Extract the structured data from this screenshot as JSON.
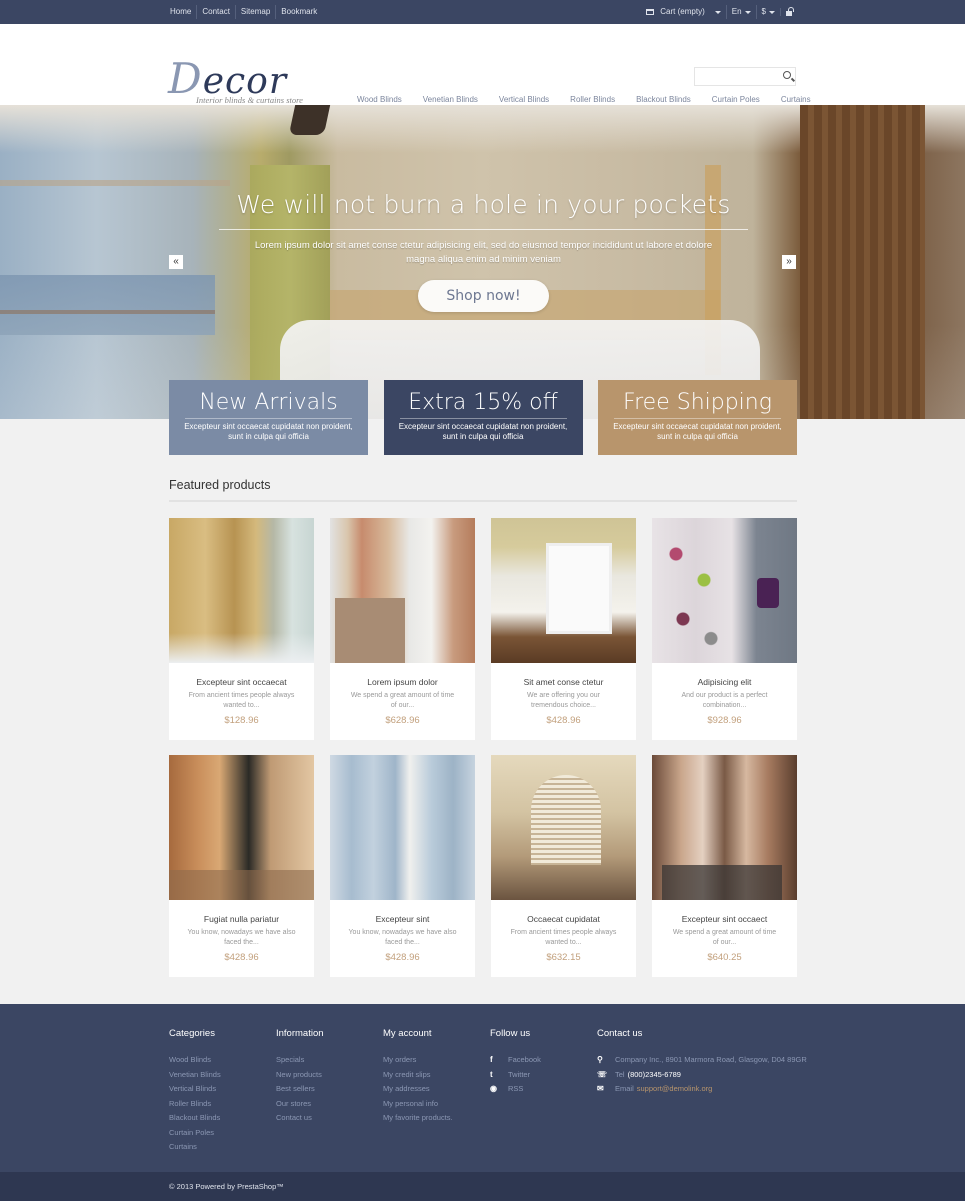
{
  "topbar": {
    "links": [
      "Home",
      "Contact",
      "Sitemap",
      "Bookmark"
    ],
    "cart_label": "Cart",
    "cart_status": "(empty)",
    "language": "En",
    "currency": "$",
    "icons": {
      "cart": "cart-icon",
      "account": "lock-icon"
    }
  },
  "header": {
    "logo_first_letter": "D",
    "logo_rest": "ecor",
    "tagline": "Interior blinds & curtains store",
    "search": {
      "value": "",
      "placeholder": ""
    },
    "nav": [
      "Wood Blinds",
      "Venetian Blinds",
      "Vertical Blinds",
      "Roller Blinds",
      "Blackout Blinds",
      "Curtain Poles",
      "Curtains"
    ]
  },
  "hero": {
    "title": "We will not burn a hole in your pockets",
    "text": "Lorem ipsum dolor sit amet conse ctetur adipisicing elit, sed do eiusmod tempor incididunt ut labore et dolore magna aliqua enim ad minim veniam",
    "button": "Shop now!",
    "prev_arrow": "«",
    "next_arrow": "»"
  },
  "promos": [
    {
      "title": "New Arrivals",
      "text": "Excepteur sint occaecat cupidatat non proident, sunt in culpa qui officia",
      "color": "#7b8ba5"
    },
    {
      "title": "Extra 15% off",
      "text": "Excepteur sint occaecat cupidatat non proident, sunt in culpa qui officia",
      "color": "#3b4663"
    },
    {
      "title": "Free Shipping",
      "text": "Excepteur sint occaecat cupidatat non proident, sunt in culpa qui officia",
      "color": "#b8956c"
    }
  ],
  "featured": {
    "heading": "Featured products",
    "products": [
      {
        "name": "Excepteur sint occaecat",
        "desc": "From ancient times people always wanted to...",
        "price": "$128.96"
      },
      {
        "name": "Lorem ipsum dolor",
        "desc": "We spend a great amount of time of our...",
        "price": "$628.96"
      },
      {
        "name": "Sit amet conse ctetur",
        "desc": "We are offering you our tremendous choice...",
        "price": "$428.96"
      },
      {
        "name": "Adipisicing elit",
        "desc": "And our product is a perfect combination...",
        "price": "$928.96"
      },
      {
        "name": "Fugiat nulla pariatur",
        "desc": "You know, nowadays we have also faced the...",
        "price": "$428.96"
      },
      {
        "name": "Excepteur sint",
        "desc": "You know, nowadays we have also faced the...",
        "price": "$428.96"
      },
      {
        "name": "Occaecat cupidatat",
        "desc": "From ancient times people always wanted to...",
        "price": "$632.15"
      },
      {
        "name": "Excepteur sint occaect",
        "desc": "We spend a great amount of time of our...",
        "price": "$640.25"
      }
    ]
  },
  "footer": {
    "categories": {
      "title": "Categories",
      "items": [
        "Wood Blinds",
        "Venetian Blinds",
        "Vertical Blinds",
        "Roller Blinds",
        "Blackout Blinds",
        "Curtain Poles",
        "Curtains"
      ]
    },
    "information": {
      "title": "Information",
      "items": [
        "Specials",
        "New products",
        "Best sellers",
        "Our stores",
        "Contact us"
      ]
    },
    "account": {
      "title": "My account",
      "items": [
        "My orders",
        "My credit slips",
        "My addresses",
        "My personal info",
        "My favorite products."
      ]
    },
    "follow": {
      "title": "Follow us",
      "items": [
        {
          "icon": "facebook-icon",
          "glyph": "f",
          "label": "Facebook"
        },
        {
          "icon": "twitter-icon",
          "glyph": "t",
          "label": "Twitter"
        },
        {
          "icon": "rss-icon",
          "glyph": "◉",
          "label": "RSS"
        }
      ]
    },
    "contact": {
      "title": "Contact us",
      "address": "Company Inc., 8901 Marmora Road, Glasgow, D04 89GR",
      "tel_label": "Tel",
      "tel": "(800)2345-6789",
      "email_label": "Email",
      "email": "support@demolink.org"
    },
    "copyright": "© 2013 Powered by PrestaShop™"
  }
}
